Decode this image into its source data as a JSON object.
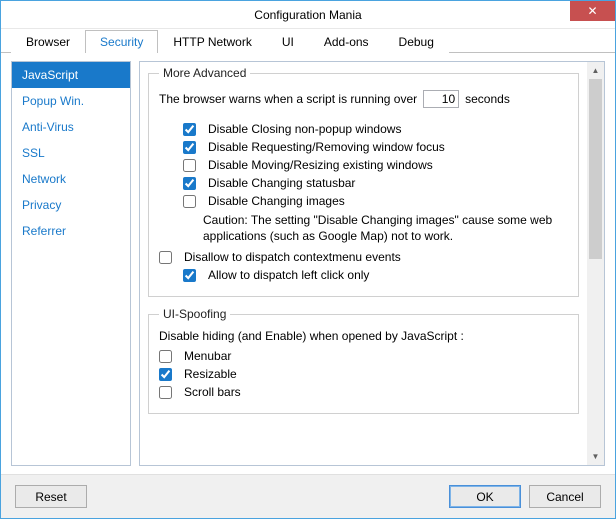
{
  "window": {
    "title": "Configuration Mania",
    "close_label": "✕"
  },
  "tabs": [
    {
      "label": "Browser"
    },
    {
      "label": "Security"
    },
    {
      "label": "HTTP Network"
    },
    {
      "label": "UI"
    },
    {
      "label": "Add-ons"
    },
    {
      "label": "Debug"
    }
  ],
  "sidebar": {
    "items": [
      {
        "label": "JavaScript"
      },
      {
        "label": "Popup Win."
      },
      {
        "label": "Anti-Virus"
      },
      {
        "label": "SSL"
      },
      {
        "label": "Network"
      },
      {
        "label": "Privacy"
      },
      {
        "label": "Referrer"
      }
    ]
  },
  "more_advanced": {
    "legend": "More Advanced",
    "warn_prefix": "The browser warns when a script is running over",
    "warn_value": "10",
    "warn_suffix": "seconds",
    "opts": [
      {
        "label": "Disable Closing non-popup windows",
        "checked": true
      },
      {
        "label": "Disable Requesting/Removing window focus",
        "checked": true
      },
      {
        "label": "Disable Moving/Resizing existing windows",
        "checked": false
      },
      {
        "label": "Disable Changing statusbar",
        "checked": true
      },
      {
        "label": "Disable Changing images",
        "checked": false
      }
    ],
    "caution": "Caution: The setting \"Disable Changing images\" cause some web applications (such as Google Map) not to work.",
    "opts2": [
      {
        "label": "Disallow to dispatch contextmenu events",
        "checked": false
      },
      {
        "label": "Allow to dispatch left click only",
        "checked": true
      }
    ]
  },
  "ui_spoofing": {
    "legend": "UI-Spoofing",
    "desc": "Disable hiding (and Enable) when opened by JavaScript :",
    "opts": [
      {
        "label": "Menubar",
        "checked": false
      },
      {
        "label": "Resizable",
        "checked": true
      },
      {
        "label": "Scroll bars",
        "checked": false
      }
    ]
  },
  "footer": {
    "reset": "Reset",
    "ok": "OK",
    "cancel": "Cancel"
  }
}
